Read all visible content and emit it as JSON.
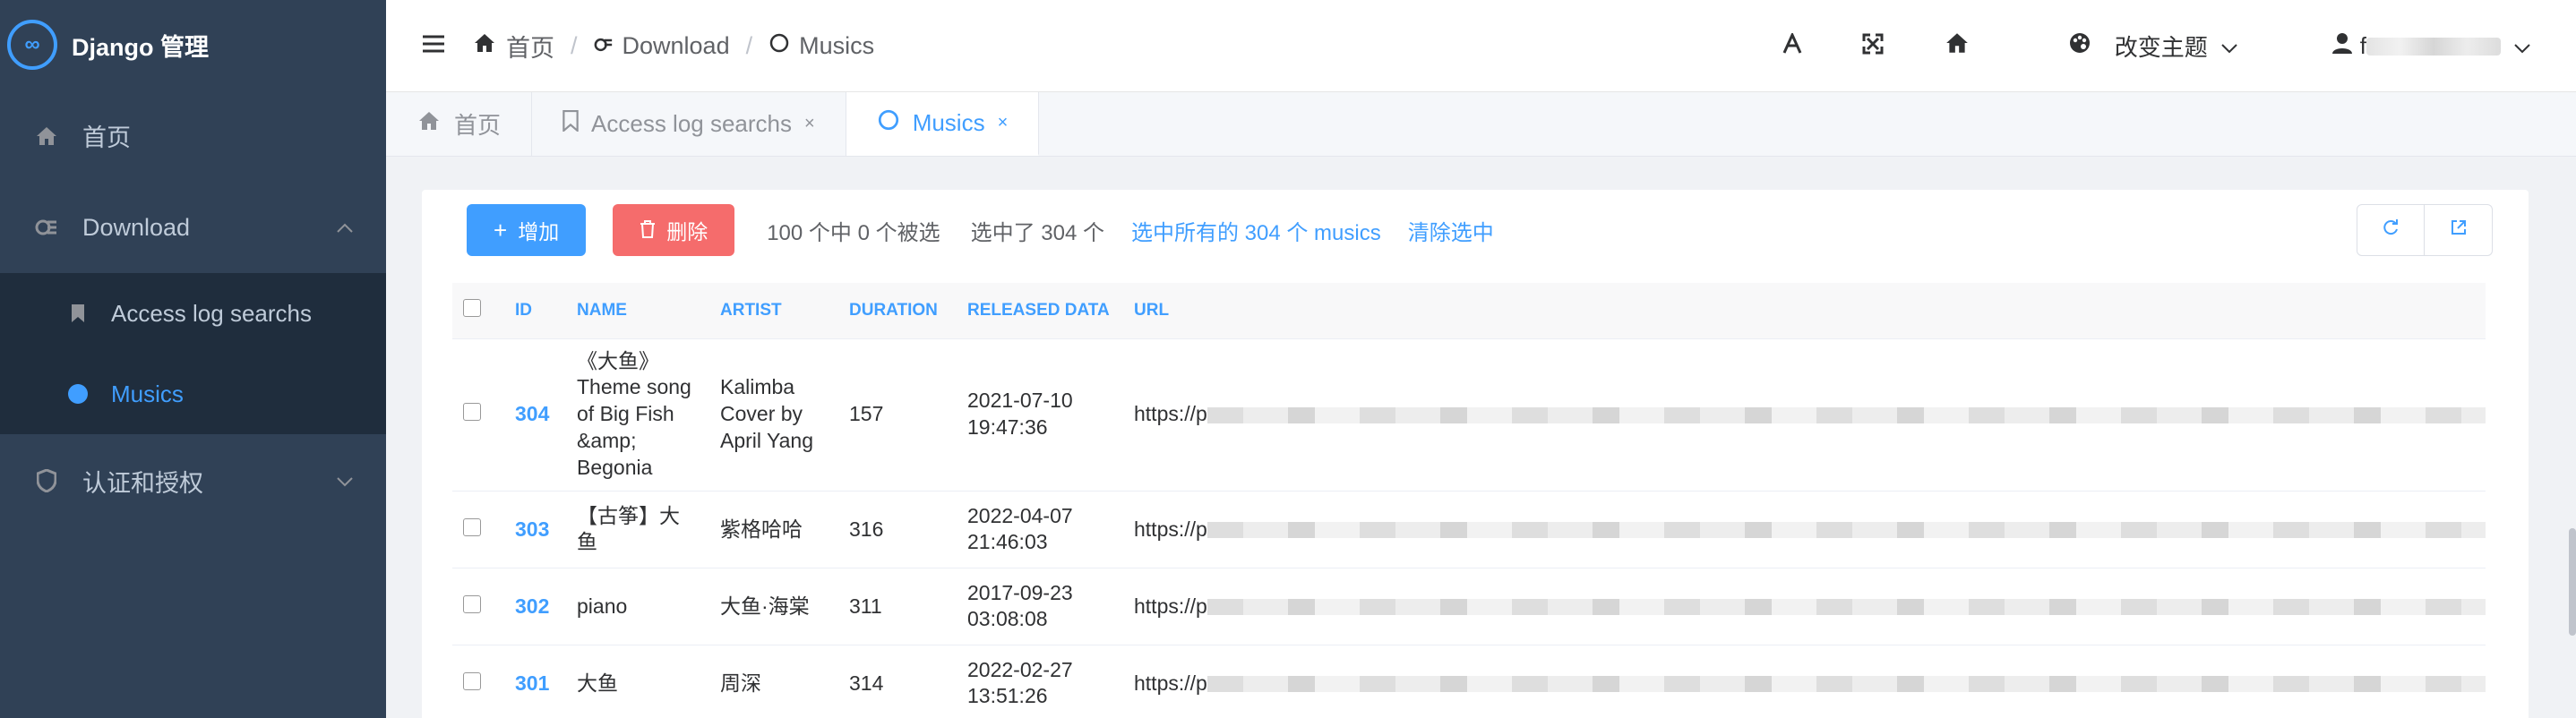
{
  "brand": {
    "logo_glyph": "∞",
    "title": "Django 管理"
  },
  "sidebar": {
    "items": [
      {
        "label": "首页",
        "icon": "home-icon"
      },
      {
        "label": "Download",
        "icon": "download-icon",
        "expanded": true,
        "children": [
          {
            "label": "Access log searchs",
            "icon": "bookmark-icon"
          },
          {
            "label": "Musics",
            "icon": "circle-dot-icon",
            "active": true
          }
        ]
      },
      {
        "label": "认证和授权",
        "icon": "shield-icon",
        "expanded": false
      }
    ]
  },
  "breadcrumb": [
    {
      "label": "首页",
      "icon": "home-icon"
    },
    {
      "label": "Download",
      "icon": "download-icon"
    },
    {
      "label": "Musics",
      "icon": "circle-icon"
    }
  ],
  "breadcrumb_sep": "/",
  "header": {
    "theme_label": "改变主题",
    "user_initial": "f"
  },
  "tabs": [
    {
      "label": "首页",
      "icon": "home-icon",
      "closable": false
    },
    {
      "label": "Access log searchs",
      "icon": "bookmark-icon",
      "closable": true,
      "close_glyph": "×"
    },
    {
      "label": "Musics",
      "icon": "circle-icon",
      "closable": true,
      "active": true,
      "close_glyph": "×"
    }
  ],
  "toolbar": {
    "add_label": "增加",
    "delete_label": "删除",
    "selected_text": "100 个中 0 个被选",
    "selected_count": "选中了 304 个",
    "select_all_link": "选中所有的 304 个 musics",
    "clear_selection_link": "清除选中"
  },
  "table": {
    "columns": [
      "ID",
      "NAME",
      "ARTIST",
      "DURATION",
      "RELEASED DATA",
      "URL"
    ],
    "rows": [
      {
        "id": "304",
        "name": "《大鱼》Theme song of Big Fish &amp; Begonia",
        "artist": "Kalimba Cover by April Yang",
        "duration": "157",
        "date": "2021-07-10 19:47:36",
        "url_prefix": "https://p"
      },
      {
        "id": "303",
        "name": "【古筝】大鱼",
        "artist": "紫格哈哈",
        "duration": "316",
        "date": "2022-04-07 21:46:03",
        "url_prefix": "https://p"
      },
      {
        "id": "302",
        "name": "piano",
        "artist": "大鱼·海棠",
        "duration": "311",
        "date": "2017-09-23 03:08:08",
        "url_prefix": "https://p"
      },
      {
        "id": "301",
        "name": "大鱼",
        "artist": "周深",
        "duration": "314",
        "date": "2022-02-27 13:51:26",
        "url_prefix": "https://p"
      }
    ]
  },
  "colors": {
    "sidebar_bg": "#304156",
    "accent": "#409eff",
    "danger": "#f56c6c"
  }
}
